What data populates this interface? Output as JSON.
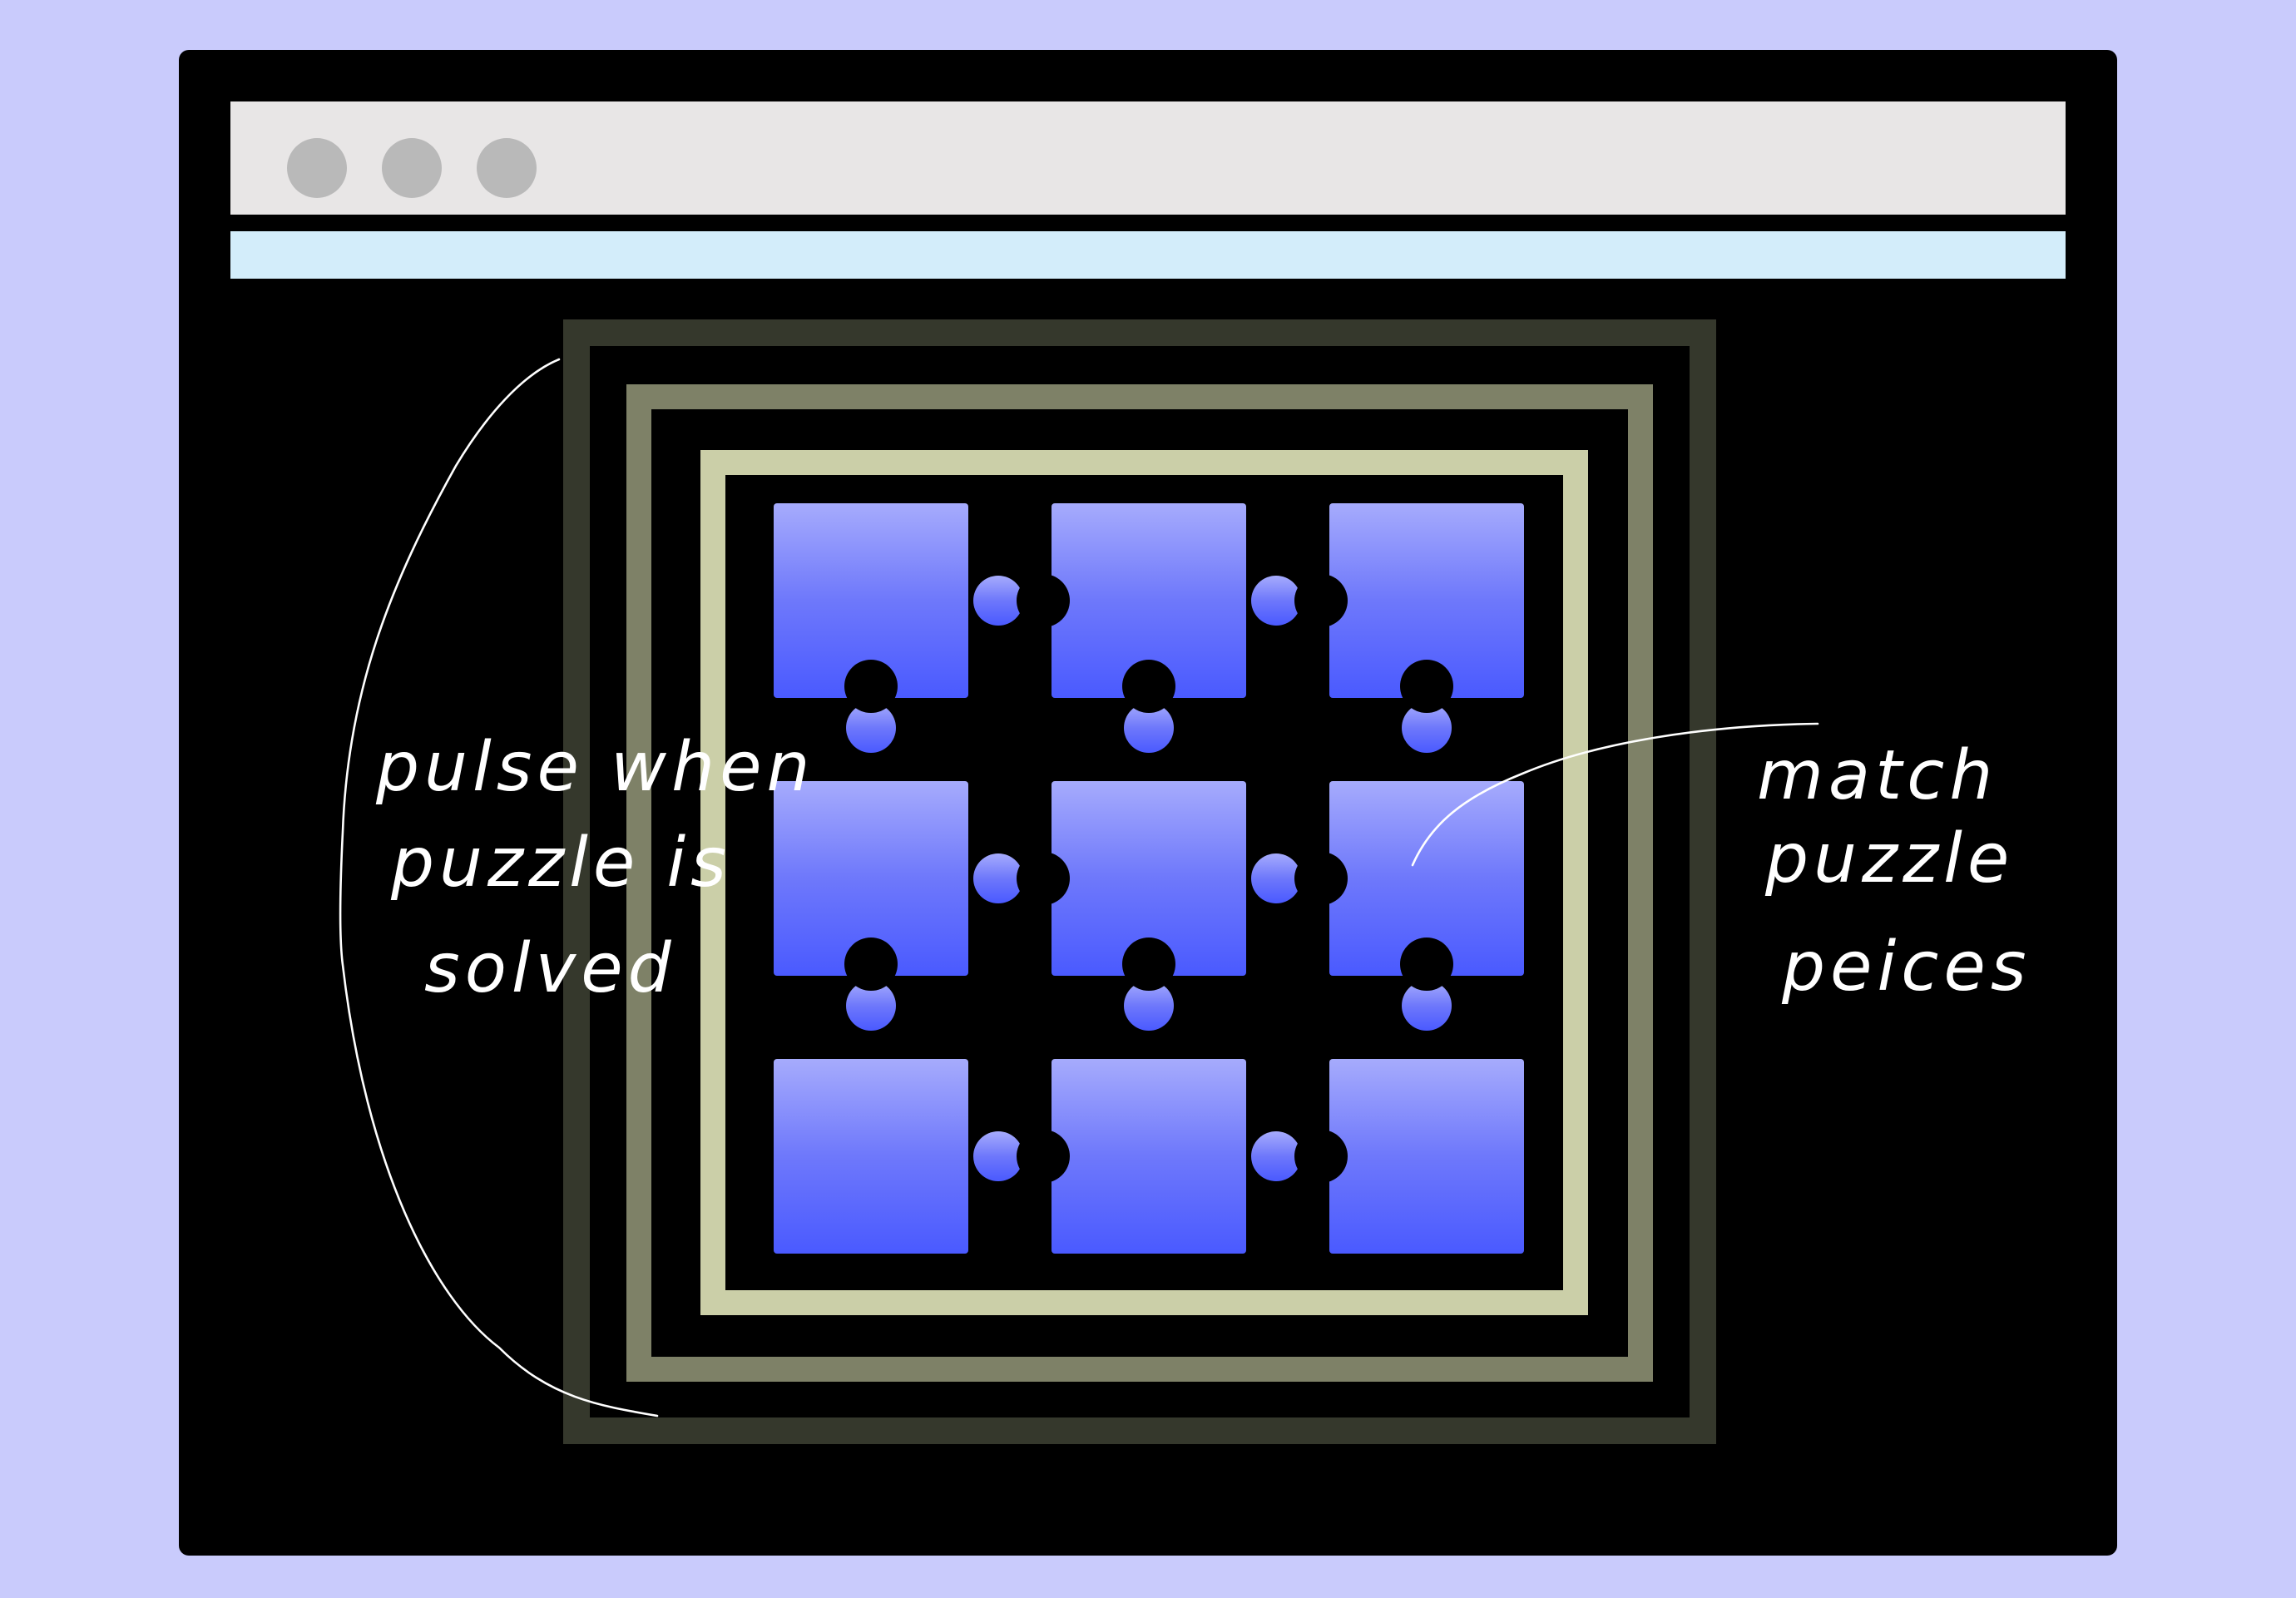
{
  "window": {
    "controls": [
      "window-dot-1",
      "window-dot-2",
      "window-dot-3"
    ]
  },
  "annotations": {
    "left_note": {
      "lines": [
        "pulse when",
        "puzzle is",
        "solved"
      ]
    },
    "right_note": {
      "lines": [
        "match",
        "puzzle",
        "peices"
      ]
    }
  },
  "puzzle": {
    "grid": "3x3",
    "colors": {
      "top": "#a6abfc",
      "middle": "#6e78fb",
      "bottom": "#4a5aff"
    },
    "frame_colors": [
      "#35382c",
      "#7e8167",
      "#cbcfa8"
    ]
  }
}
